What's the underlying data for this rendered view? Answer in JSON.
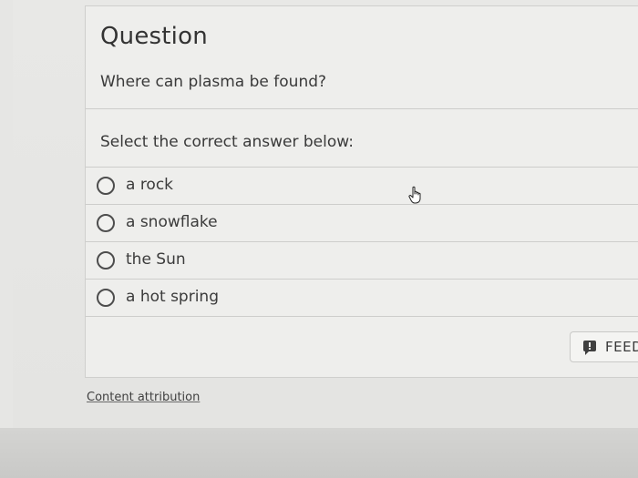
{
  "question": {
    "title": "Question",
    "text": "Where can plasma be found?"
  },
  "prompt": "Select the correct answer below:",
  "options": [
    {
      "label": "a rock",
      "selected": false
    },
    {
      "label": "a snowflake",
      "selected": false
    },
    {
      "label": "the Sun",
      "selected": false
    },
    {
      "label": "a hot spring",
      "selected": false
    }
  ],
  "footer": {
    "attribution_label": "Content attribution"
  },
  "feedback": {
    "label": "FEED",
    "icon": "feedback-icon"
  },
  "cursor": {
    "icon": "hand-pointer-icon"
  }
}
